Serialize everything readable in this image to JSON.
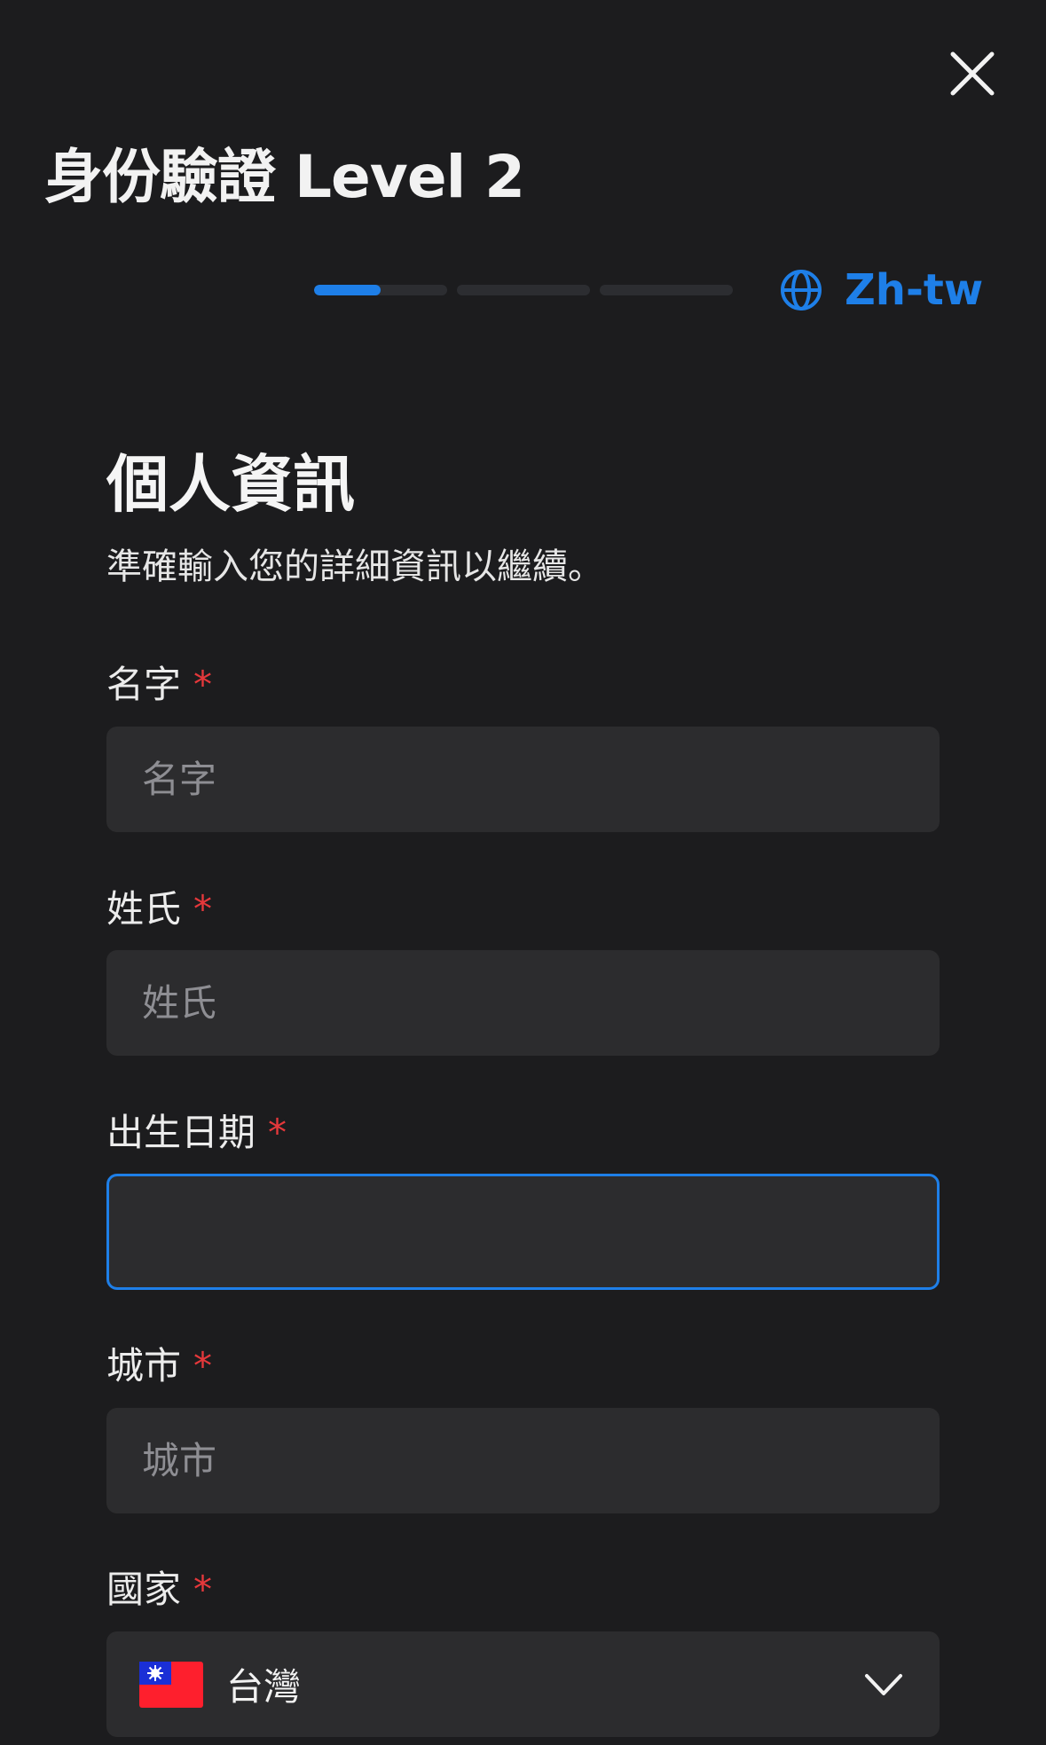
{
  "header": {
    "title": "身份驗證 Level 2",
    "language_label": "Zh-tw"
  },
  "progress": {
    "total_steps": 3,
    "current_step": 1,
    "current_step_fraction": 0.5
  },
  "section": {
    "title": "個人資訊",
    "subtitle": "準確輸入您的詳細資訊以繼續。"
  },
  "form": {
    "required_marker": "*",
    "first_name": {
      "label": "名字",
      "placeholder": "名字",
      "value": ""
    },
    "last_name": {
      "label": "姓氏",
      "placeholder": "姓氏",
      "value": ""
    },
    "birth_date": {
      "label": "出生日期",
      "placeholder": "",
      "value": ""
    },
    "city": {
      "label": "城市",
      "placeholder": "城市",
      "value": ""
    },
    "country": {
      "label": "國家",
      "value": "台灣",
      "flag_icon": "taiwan-flag-icon"
    }
  },
  "colors": {
    "background": "#1c1c1e",
    "field_background": "#2c2c2e",
    "accent": "#1e7fe8",
    "required": "#e5383b",
    "placeholder": "#8e8e93"
  },
  "icons": {
    "close": "close-icon",
    "language": "globe-icon",
    "dropdown": "chevron-down-icon"
  }
}
